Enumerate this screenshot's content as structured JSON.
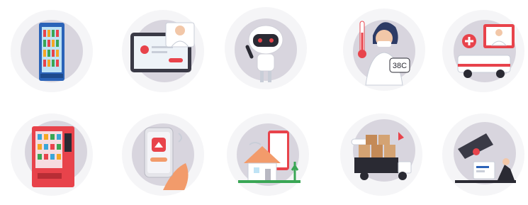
{
  "tiles": [
    {
      "icon": "vending-fridge-icon"
    },
    {
      "icon": "telemedicine-tablet-icon"
    },
    {
      "icon": "robot-icon"
    },
    {
      "icon": "thermometer-woman-icon",
      "temperature_label": "38C"
    },
    {
      "icon": "ambulance-doctor-icon"
    },
    {
      "icon": "vending-machine-icon"
    },
    {
      "icon": "smart-home-phone-icon"
    },
    {
      "icon": "smart-house-icon"
    },
    {
      "icon": "delivery-truck-icon"
    },
    {
      "icon": "cctv-security-icon"
    }
  ],
  "colors": {
    "accent": "#e8434b",
    "circle_bg": "#d8d5de",
    "ring": "#ececf0"
  }
}
